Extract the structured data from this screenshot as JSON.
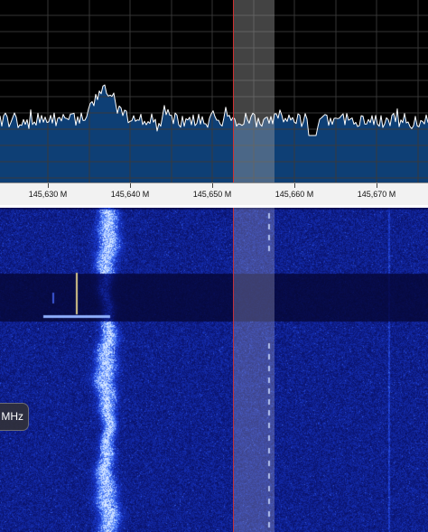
{
  "spectrum": {
    "background_color": "#000000",
    "grid_color": "#3a3a3a",
    "fill_color": "#0e3f75",
    "trace_color": "#ffffff",
    "filter_band_color": "#a0a0a0",
    "tuning_line_color": "#d03030"
  },
  "frequency_axis": {
    "ticks": [
      {
        "label": "145,630 M"
      },
      {
        "label": "145,640 M"
      },
      {
        "label": "145,650 M"
      },
      {
        "label": "145,660 M"
      },
      {
        "label": "145,670 M"
      }
    ]
  },
  "waterfall": {
    "palette": [
      "#05052a",
      "#0a1470",
      "#1a3ad0",
      "#5a8cff",
      "#d8e8ff"
    ]
  },
  "tooltip": {
    "text": "MHz"
  }
}
